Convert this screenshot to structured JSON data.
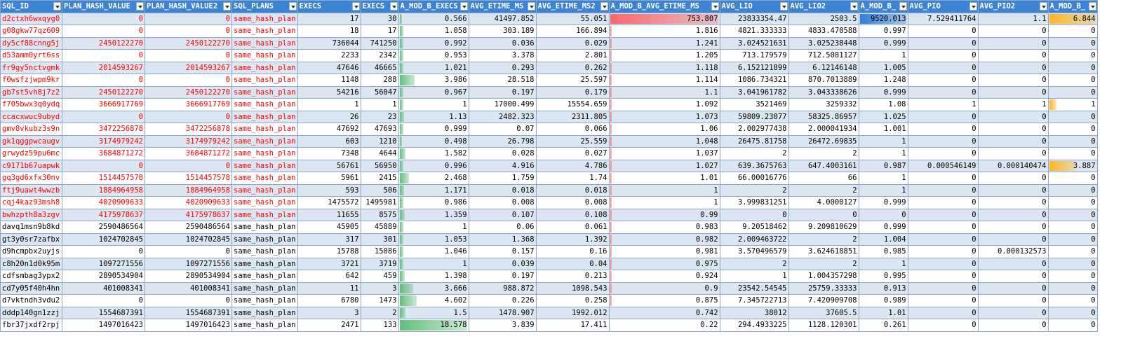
{
  "columns": [
    "SQL_ID",
    "PLAN_HASH_VALUE",
    "PLAN_HASH_VALUE2",
    "SQL_PLANS",
    "EXECS",
    "EXECS",
    "A_MOD_B_EXECS",
    "AVG_ETIME_MS",
    "AVG_ETIME_MS2",
    "A_MOD_B_AVG_ETIME_MS",
    "AVG_LIO",
    "AVG_LIO2",
    "A_MOD_B_",
    "AVG_PIO",
    "AVG_PIO2",
    "A_MOD_B_"
  ],
  "header_display": [
    "SQL_ID",
    "PLAN_HASH_VALUE",
    "PLAN_HASH_VALUE2",
    "SQL_PLANS",
    "EXECS",
    "EXECS",
    "A_MOD_B_EXECS",
    "AVG_ETIME_MS",
    "AVG_ETIME_MS2",
    "A_MOD_B_AVG_ETIME_MS",
    "AVG_LIO",
    "AVG_LIO2",
    "A_MOD_B_",
    "AVG_PIO",
    "AVG_PIO2",
    "A_MOD_B_"
  ],
  "rows": [
    {
      "red": true,
      "cells": [
        "d2ctxh6wxqyg0",
        "0",
        "0",
        "same_hash_plan",
        "17",
        "30",
        "0.566",
        "41497.852",
        "55.051",
        "753.807",
        "23833354.47",
        "2503.5",
        "9520.013",
        "7.529411764",
        "1.1",
        "6.844"
      ]
    },
    {
      "red": true,
      "cells": [
        "g08gkw77qz609",
        "0",
        "0",
        "same_hash_plan",
        "18",
        "17",
        "1.058",
        "303.189",
        "166.894",
        "1.816",
        "4821.333333",
        "4833.470588",
        "0.997",
        "0",
        "0",
        "0"
      ]
    },
    {
      "red": true,
      "cells": [
        "dy5cf88cnng5j",
        "2450122270",
        "2450122270",
        "same_hash_plan",
        "736044",
        "741250",
        "0.992",
        "0.036",
        "0.029",
        "1.241",
        "3.024521631",
        "3.025238448",
        "0.999",
        "0",
        "0",
        "0"
      ]
    },
    {
      "red": true,
      "cells": [
        "d53amm0yrt6ss",
        "0",
        "0",
        "same_hash_plan",
        "2233",
        "2342",
        "0.953",
        "3.378",
        "2.801",
        "1.205",
        "713.179579",
        "712.5081127",
        "1",
        "0",
        "0",
        "0"
      ]
    },
    {
      "red": true,
      "cells": [
        "fr9gy5nctvgmk",
        "2014593267",
        "2014593267",
        "same_hash_plan",
        "47646",
        "46665",
        "1.021",
        "0.293",
        "0.262",
        "1.118",
        "6.152121899",
        "6.12146148",
        "1.005",
        "0",
        "0",
        "0"
      ]
    },
    {
      "red": true,
      "cells": [
        "f0wsfzjwpm9kr",
        "0",
        "0",
        "same_hash_plan",
        "1148",
        "288",
        "3.986",
        "28.518",
        "25.597",
        "1.114",
        "1086.734321",
        "870.7013889",
        "1.248",
        "0",
        "0",
        "0"
      ]
    },
    {
      "red": true,
      "cells": [
        "gb7st5vh8j7z2",
        "2450122270",
        "2450122270",
        "same_hash_plan",
        "54216",
        "56047",
        "0.967",
        "0.197",
        "0.179",
        "1.1",
        "3.041961782",
        "3.043338626",
        "0.999",
        "0",
        "0",
        "0"
      ]
    },
    {
      "red": true,
      "cells": [
        "f705bwx3q0ydq",
        "3666917769",
        "3666917769",
        "same_hash_plan",
        "1",
        "1",
        "1",
        "17000.499",
        "15554.659",
        "1.092",
        "3521469",
        "3259332",
        "1.08",
        "1",
        "1",
        "1"
      ]
    },
    {
      "red": true,
      "cells": [
        "ccacxwuc9ubyd",
        "0",
        "0",
        "same_hash_plan",
        "26",
        "23",
        "1.13",
        "2482.323",
        "2311.805",
        "1.073",
        "59809.23077",
        "58325.86957",
        "1.025",
        "0",
        "0",
        "0"
      ]
    },
    {
      "red": true,
      "cells": [
        "gmv8vkubz3s9n",
        "3472256878",
        "3472256878",
        "same_hash_plan",
        "47692",
        "47693",
        "0.999",
        "0.07",
        "0.066",
        "1.06",
        "2.002977438",
        "2.000041934",
        "1.001",
        "0",
        "0",
        "0"
      ]
    },
    {
      "red": true,
      "cells": [
        "gk1qggpwcaugv",
        "3174979242",
        "3174979242",
        "same_hash_plan",
        "603",
        "1210",
        "0.498",
        "26.798",
        "25.559",
        "1.048",
        "26475.81758",
        "26472.69835",
        "1",
        "0",
        "0",
        "0"
      ]
    },
    {
      "red": true,
      "cells": [
        "grwydz59pu6mc",
        "3684871272",
        "3684871272",
        "same_hash_plan",
        "7348",
        "4644",
        "1.582",
        "0.028",
        "0.027",
        "1.037",
        "2",
        "2",
        "1",
        "0",
        "0",
        "0"
      ]
    },
    {
      "red": true,
      "cells": [
        "c9171b67uapwk",
        "0",
        "0",
        "same_hash_plan",
        "56761",
        "56950",
        "0.996",
        "4.916",
        "4.786",
        "1.027",
        "639.3675763",
        "647.4003161",
        "0.987",
        "0.000546149",
        "0.000140474",
        "3.887"
      ]
    },
    {
      "red": true,
      "cells": [
        "gq3gd6xfx30nv",
        "1514457578",
        "1514457578",
        "same_hash_plan",
        "5961",
        "2415",
        "2.468",
        "1.759",
        "1.74",
        "1.01",
        "66.00016776",
        "66",
        "1",
        "0",
        "0",
        "0"
      ]
    },
    {
      "red": true,
      "cells": [
        "ftj9uawt4wwzb",
        "1884964958",
        "1884964958",
        "same_hash_plan",
        "593",
        "506",
        "1.171",
        "0.018",
        "0.018",
        "1",
        "2",
        "2",
        "1",
        "0",
        "0",
        "0"
      ]
    },
    {
      "red": true,
      "cells": [
        "cqj4kaz93msh8",
        "4020909633",
        "4020909633",
        "same_hash_plan",
        "1475572",
        "1495981",
        "0.986",
        "0.008",
        "0.008",
        "1",
        "3.999831251",
        "4.0000127",
        "0.999",
        "0",
        "0",
        "0"
      ]
    },
    {
      "red": true,
      "cells": [
        "bwhzpth8a3zgv",
        "4175978637",
        "4175978637",
        "same_hash_plan",
        "11655",
        "8575",
        "1.359",
        "0.107",
        "0.108",
        "0.99",
        "0",
        "0",
        "0",
        "0",
        "0",
        "0"
      ]
    },
    {
      "red": false,
      "cells": [
        "davq1msn9b8kd",
        "2590486564",
        "2590486564",
        "same_hash_plan",
        "45905",
        "45889",
        "1",
        "0.06",
        "0.061",
        "0.983",
        "9.20518462",
        "9.209810629",
        "0.999",
        "0",
        "0",
        "0"
      ]
    },
    {
      "red": false,
      "cells": [
        "gt3y0sr7zafbx",
        "1024702845",
        "1024702845",
        "same_hash_plan",
        "317",
        "301",
        "1.053",
        "1.368",
        "1.392",
        "0.982",
        "2.009463722",
        "2",
        "1.004",
        "0",
        "0",
        "0"
      ]
    },
    {
      "red": false,
      "cells": [
        "d9hcmpbx2uyjs",
        "0",
        "0",
        "same_hash_plan",
        "15788",
        "15086",
        "1.046",
        "0.157",
        "0.16",
        "0.981",
        "3.570496579",
        "3.624618851",
        "0.985",
        "0",
        "0.000132573",
        "0"
      ]
    },
    {
      "red": false,
      "cells": [
        "c8h20n1d0k95m",
        "1097271556",
        "1097271556",
        "same_hash_plan",
        "3721",
        "3719",
        "1",
        "0.039",
        "0.04",
        "0.975",
        "2",
        "2",
        "1",
        "0",
        "0",
        "0"
      ]
    },
    {
      "red": false,
      "cells": [
        "cdfsmbag3ypx2",
        "2890534904",
        "2890534904",
        "same_hash_plan",
        "642",
        "459",
        "1.398",
        "0.197",
        "0.213",
        "0.924",
        "1",
        "1.004357298",
        "0.995",
        "0",
        "0",
        "0"
      ]
    },
    {
      "red": false,
      "cells": [
        "cd7y05f40h4hn",
        "401008341",
        "401008341",
        "same_hash_plan",
        "11",
        "3",
        "3.666",
        "988.872",
        "1098.543",
        "0.9",
        "23542.54545",
        "25759.33333",
        "0.913",
        "0",
        "0",
        "0"
      ]
    },
    {
      "red": false,
      "cells": [
        "d7vktndh3vdu2",
        "0",
        "0",
        "same_hash_plan",
        "6780",
        "1473",
        "4.602",
        "0.226",
        "0.258",
        "0.875",
        "7.345722713",
        "7.420909708",
        "0.989",
        "0",
        "0",
        "0"
      ]
    },
    {
      "red": false,
      "cells": [
        "dddp140gn1zzj",
        "1554687391",
        "1554687391",
        "same_hash_plan",
        "3",
        "2",
        "1.5",
        "1478.907",
        "1992.012",
        "0.742",
        "38012",
        "37605.5",
        "1.01",
        "0",
        "0",
        "0"
      ]
    },
    {
      "red": false,
      "cells": [
        "fbr37jxdf2rpj",
        "1497016423",
        "1497016423",
        "same_hash_plan",
        "2471",
        "133",
        "18.578",
        "3.839",
        "17.411",
        "0.22",
        "294.4933225",
        "1128.120301",
        "0.261",
        "0",
        "0",
        "0"
      ]
    }
  ],
  "colors": {
    "header_bg": "#3d83d3",
    "band_bg": "#dce6f2",
    "grid_line": "#8ea8c6",
    "highlight_text": "#ff0000",
    "bar_green": "#63be7b",
    "bar_red": "#f8696b",
    "bar_blue": "#2f7ed8",
    "bar_orange": "#ffb628"
  },
  "data_bars": [
    {
      "column": 6,
      "max": 18.578,
      "color": "#63be7b"
    },
    {
      "column": 9,
      "max": 753.807,
      "color": "#f8696b"
    },
    {
      "column": 12,
      "max": 9520.013,
      "color": "#2f7ed8"
    },
    {
      "column": 15,
      "max": 6.844,
      "color": "#ffb628"
    }
  ]
}
